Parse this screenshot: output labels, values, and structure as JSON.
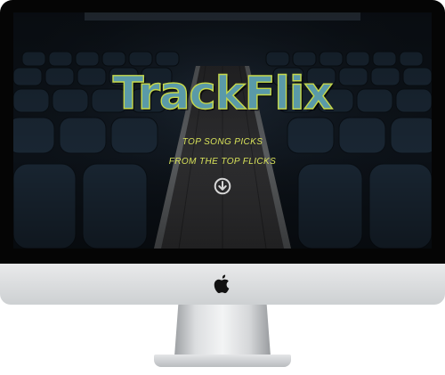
{
  "hero": {
    "title": "TrackFlix",
    "tagline_line_1": "TOP SONG PICKS",
    "tagline_line_2": "FROM THE TOP FLICKS"
  },
  "icons": {
    "scroll_down": "arrow-down-circle-icon",
    "brand": "apple-logo-icon"
  },
  "colors": {
    "title_fill": "#5a9aa8",
    "title_outline": "#c6d84a",
    "tagline": "#d9e35a",
    "screen_background": "#0c1117"
  }
}
